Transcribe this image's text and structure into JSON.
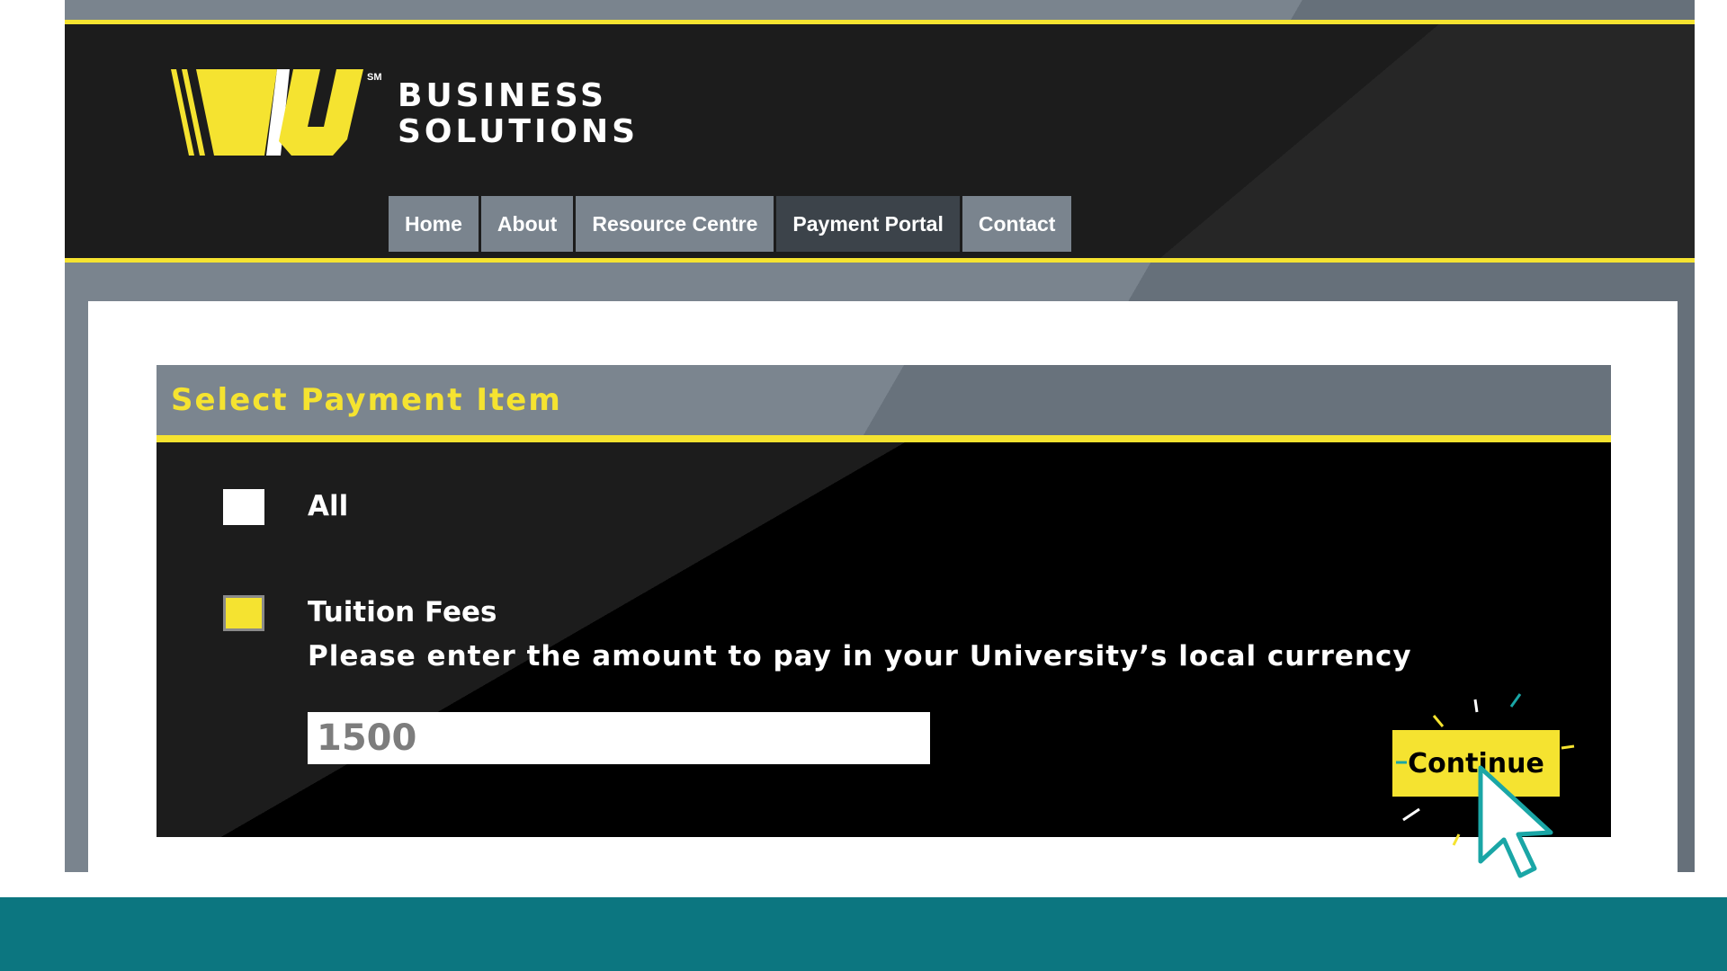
{
  "brand": {
    "logo_text": "WU",
    "logo_mark": "SM",
    "line1": "BUSINESS",
    "line2": "SOLUTIONS"
  },
  "nav": {
    "items": [
      {
        "label": "Home"
      },
      {
        "label": "About"
      },
      {
        "label": "Resource Centre"
      },
      {
        "label": "Payment Portal",
        "active": true
      },
      {
        "label": "Contact"
      }
    ]
  },
  "panel": {
    "title": "Select Payment Item",
    "options": [
      {
        "label": "All",
        "checked": false
      },
      {
        "label": "Tuition Fees",
        "checked": true
      }
    ],
    "hint": "Please enter the amount to pay in your University’s local currency",
    "amount_value": "1500",
    "continue_label": "Continue"
  },
  "colors": {
    "accent_yellow": "#f5e330",
    "header_dark": "#1c1c1c",
    "frame_gray": "#7a848e",
    "footer_teal": "#0c7680"
  },
  "icons": [
    "wu-logo-icon",
    "mouse-cursor-icon",
    "click-sparkle-icon"
  ]
}
